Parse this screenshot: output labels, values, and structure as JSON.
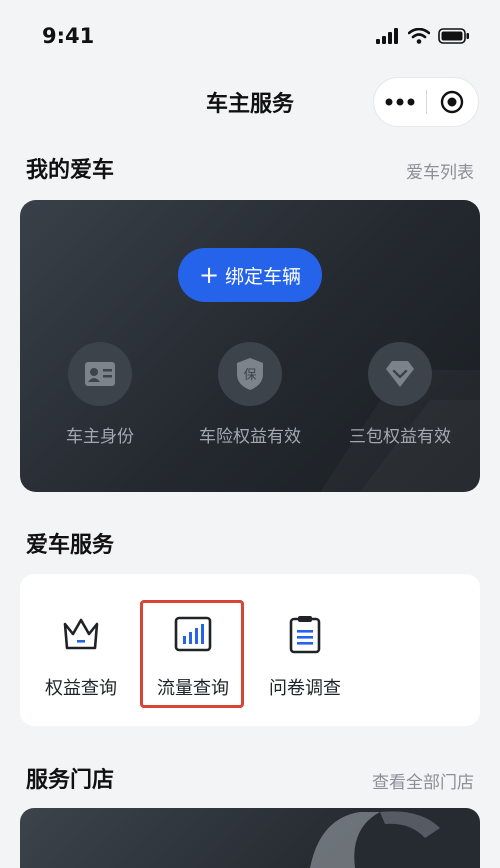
{
  "status": {
    "time": "9:41"
  },
  "nav": {
    "title": "车主服务"
  },
  "my_car": {
    "title": "我的爱车",
    "link": "爱车列表",
    "bind_button": "绑定车辆",
    "features": [
      {
        "icon": "id-card-icon",
        "label": "车主身份"
      },
      {
        "icon": "insurance-shield-icon",
        "label": "车险权益有效",
        "glyph": "保"
      },
      {
        "icon": "diamond-icon",
        "label": "三包权益有效"
      }
    ]
  },
  "car_service": {
    "title": "爱车服务",
    "items": [
      {
        "icon": "crown-icon",
        "label": "权益查询"
      },
      {
        "icon": "bar-chart-icon",
        "label": "流量查询"
      },
      {
        "icon": "clipboard-icon",
        "label": "问卷调查"
      }
    ]
  },
  "stores": {
    "title": "服务门店",
    "link": "查看全部门店"
  },
  "colors": {
    "accent": "#2563eb",
    "highlight": "#d64535",
    "card_dark": "#24292f"
  }
}
